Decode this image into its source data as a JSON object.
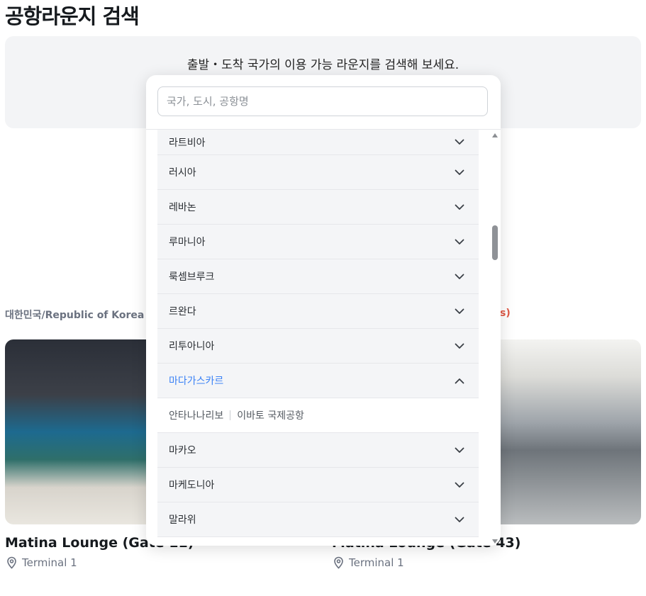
{
  "page": {
    "title": "공항라운지 검색",
    "hero_text": "출발・도착 국가의 이용 가능 라운지를 검색해 보세요."
  },
  "background": {
    "crumb_left": "대한민국/Republic of Korea >",
    "crumb_right": "s)",
    "cards": [
      {
        "title": "Matina Lounge (Gate 11)",
        "terminal": "Terminal 1"
      },
      {
        "title": "Matina Lounge (Gate 43)",
        "terminal": "Terminal 1"
      }
    ]
  },
  "dropdown": {
    "search_placeholder": "국가, 도시, 공항명",
    "countries": [
      {
        "label": "라트비아",
        "state": "collapsed"
      },
      {
        "label": "러시아",
        "state": "collapsed"
      },
      {
        "label": "레바논",
        "state": "collapsed"
      },
      {
        "label": "루마니아",
        "state": "collapsed"
      },
      {
        "label": "룩셈브루크",
        "state": "collapsed"
      },
      {
        "label": "르완다",
        "state": "collapsed"
      },
      {
        "label": "리투아니아",
        "state": "collapsed"
      },
      {
        "label": "마다가스카르",
        "state": "expanded"
      },
      {
        "label": "마카오",
        "state": "collapsed"
      },
      {
        "label": "마케도니아",
        "state": "collapsed"
      },
      {
        "label": "말라위",
        "state": "collapsed"
      }
    ],
    "expanded_entry": {
      "city": "안타나나리보",
      "airport": "이바토 국제공항"
    }
  },
  "colors": {
    "accent": "#3b82f6",
    "row_bg": "#f4f5f7",
    "hero_bg": "#f3f4f6"
  },
  "icons": {
    "chevron_down": "chevron-down-icon",
    "chevron_up": "chevron-up-icon",
    "pin": "location-pin-icon"
  }
}
